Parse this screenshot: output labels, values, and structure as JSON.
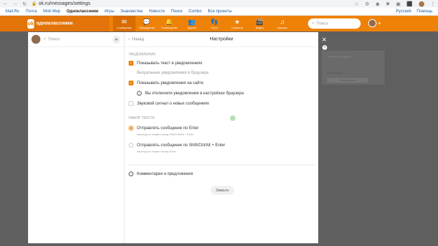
{
  "browser": {
    "url": "ok.ru/messages/settings"
  },
  "portal": {
    "links": [
      "Mail.Ru",
      "Почта",
      "Мой Мир",
      "Одноклассники",
      "Игры",
      "Знакомства",
      "Новости",
      "Поиск",
      "Combo",
      "Все проекты"
    ],
    "lang": "Русский",
    "help": "Помощь"
  },
  "toolbar": {
    "logo": "одноклассники",
    "items": [
      {
        "label": "Сообщения",
        "icon": "✉"
      },
      {
        "label": "Обсуждения",
        "icon": "💬"
      },
      {
        "label": "Оповещения",
        "icon": "🔔"
      },
      {
        "label": "Друзья",
        "icon": "👥"
      },
      {
        "label": "Гости",
        "icon": "👣"
      },
      {
        "label": "События",
        "icon": "★"
      },
      {
        "label": "Видео",
        "icon": "🎬"
      },
      {
        "label": "Музыка",
        "icon": "♫"
      }
    ],
    "search_placeholder": "Поиск"
  },
  "left_panel": {
    "search_placeholder": "Поиск"
  },
  "settings": {
    "back_label": "Назад",
    "title": "Настройки",
    "notifications_header": "Уведомления",
    "show_text": "Показывать текст в уведомлениях",
    "visual_browser": "Визуальные уведомления в браузере",
    "show_on_site": "Показывать уведомления на сайте",
    "disabled_info": "Вы отключили уведомления в настройках браузера",
    "sound": "Звуковой сигнал о новых сообщениях",
    "typing_header": "Набор текста",
    "send_enter": "Отправлять сообщение по Enter",
    "send_enter_hint": "переход на новую строку Shift/Ctrl/Alt + Enter",
    "send_shift": "Отправлять сообщение по Shift/Ctrl/Alt + Enter",
    "send_shift_hint": "переход на новую строку Enter",
    "feedback": "Комментарии и предложения",
    "close_label": "Закрыть"
  },
  "backdrop": {
    "card_text1": "Пригласить друзей",
    "card_text2": "Фотографии",
    "card_text3": "Участвовать"
  }
}
